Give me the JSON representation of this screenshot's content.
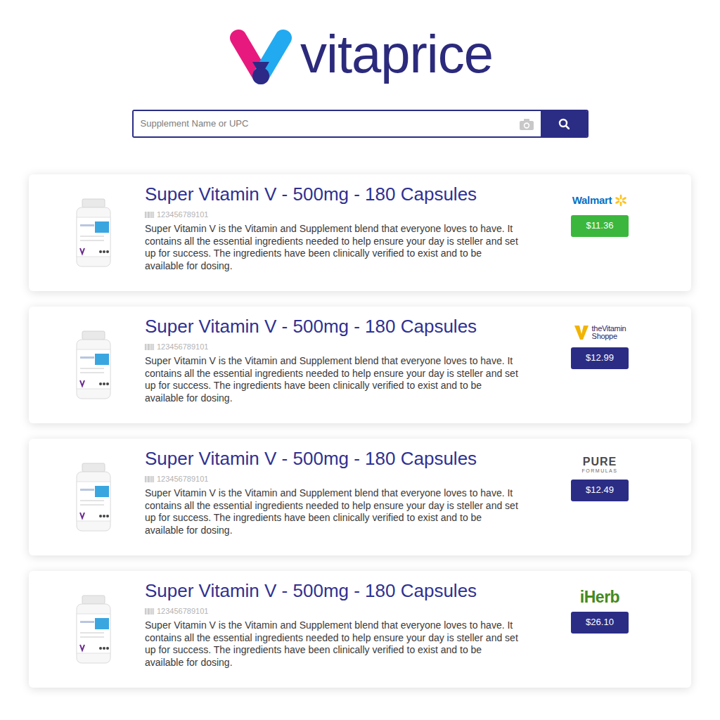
{
  "logo": {
    "text": "vitaprice"
  },
  "search": {
    "placeholder": "Supplement Name or UPC"
  },
  "results": [
    {
      "title": "Super Vitamin V - 500mg - 180 Capsules",
      "upc": "123456789101",
      "description": "Super Vitamin V is the Vitamin and Supplement blend that everyone loves to have. It contains all the essential ingredients needed to help ensure your day is steller and set up for success. The ingredients have been clinically verified to exist and to be available for dosing.",
      "store": {
        "kind": "walmart",
        "lines": [
          "Walmart"
        ]
      },
      "price": "$11.36",
      "best_price": true
    },
    {
      "title": "Super Vitamin V - 500mg - 180 Capsules",
      "upc": "123456789101",
      "description": "Super Vitamin V is the Vitamin and Supplement blend that everyone loves to have. It contains all the essential ingredients needed to help ensure your day is steller and set up for success. The ingredients have been clinically verified to exist and to be available for dosing.",
      "store": {
        "kind": "vitamin-shoppe",
        "lines": [
          "theVitamin",
          "Shoppe"
        ]
      },
      "price": "$12.99",
      "best_price": false
    },
    {
      "title": "Super Vitamin V - 500mg - 180 Capsules",
      "upc": "123456789101",
      "description": "Super Vitamin V is the Vitamin and Supplement blend that everyone loves to have. It contains all the essential ingredients needed to help ensure your day is steller and set up for success. The ingredients have been clinically verified to exist and to be available for dosing.",
      "store": {
        "kind": "pure-formulas",
        "lines": [
          "PURE",
          "FORMULAS"
        ]
      },
      "price": "$12.49",
      "best_price": false
    },
    {
      "title": "Super Vitamin V - 500mg - 180 Capsules",
      "upc": "123456789101",
      "description": "Super Vitamin V is the Vitamin and Supplement blend that everyone loves to have. It contains all the essential ingredients needed to help ensure your day is steller and set up for success. The ingredients have been clinically verified to exist and to be available for dosing.",
      "store": {
        "kind": "iherb",
        "lines": [
          "iHerb"
        ]
      },
      "price": "$26.10",
      "best_price": false
    }
  ]
}
